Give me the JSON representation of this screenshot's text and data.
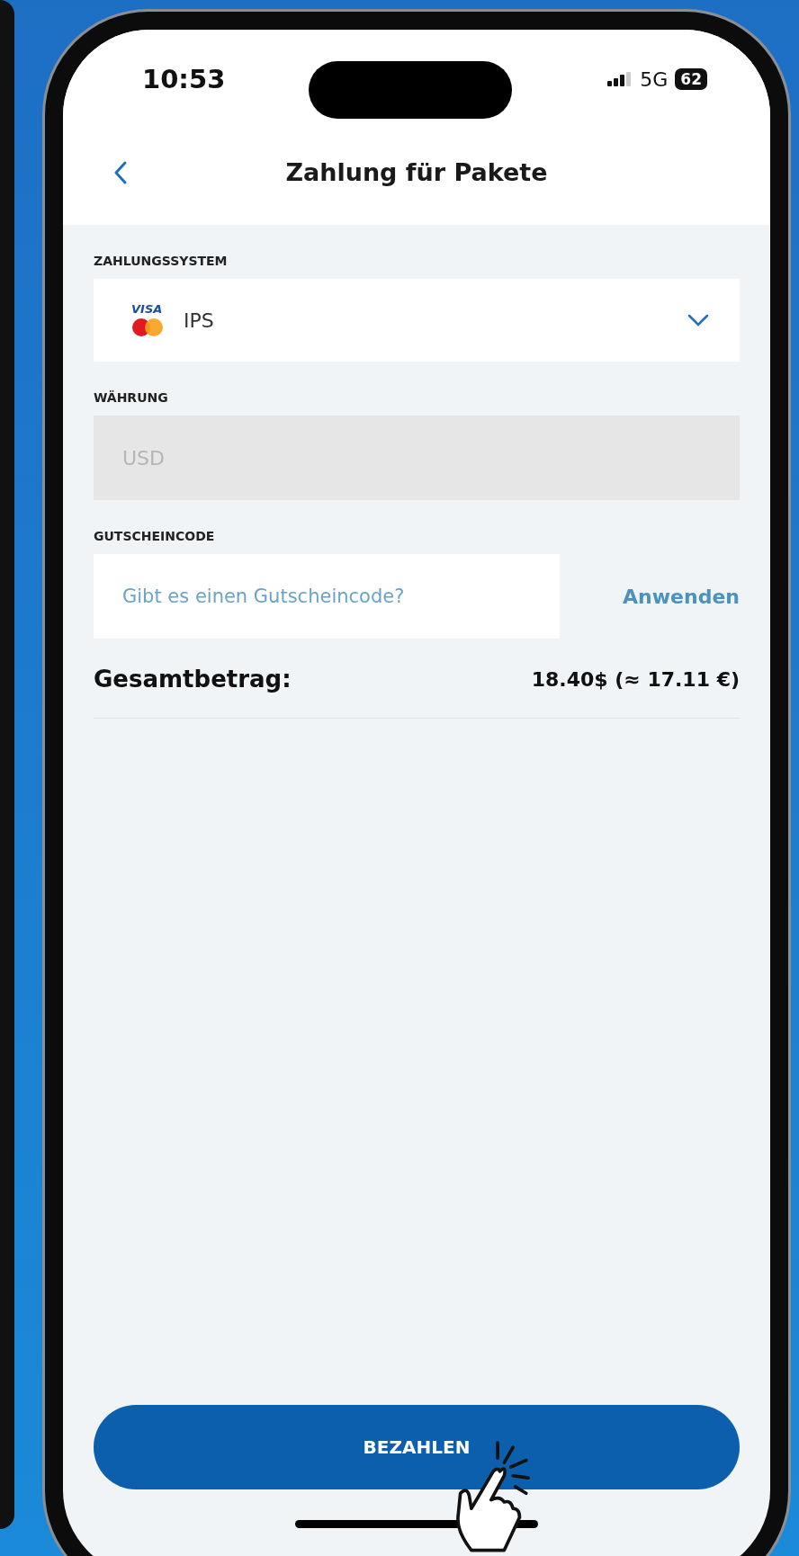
{
  "status_bar": {
    "time": "10:53",
    "network": "5G",
    "battery": "62"
  },
  "header": {
    "title": "Zahlung für Pakete"
  },
  "payment_system": {
    "label": "ZAHLUNGSSYSTEM",
    "logo_text": "VISA",
    "value": "IPS"
  },
  "currency": {
    "label": "WÄHRUNG",
    "value": "USD",
    "disabled": true
  },
  "coupon": {
    "label": "GUTSCHEINCODE",
    "placeholder": "Gibt es einen Gutscheincode?",
    "apply": "Anwenden"
  },
  "total": {
    "label": "Gesamtbetrag:",
    "amount": "18.40$ (≈ 17.11 €)"
  },
  "pay_button": "BEZAHLEN"
}
